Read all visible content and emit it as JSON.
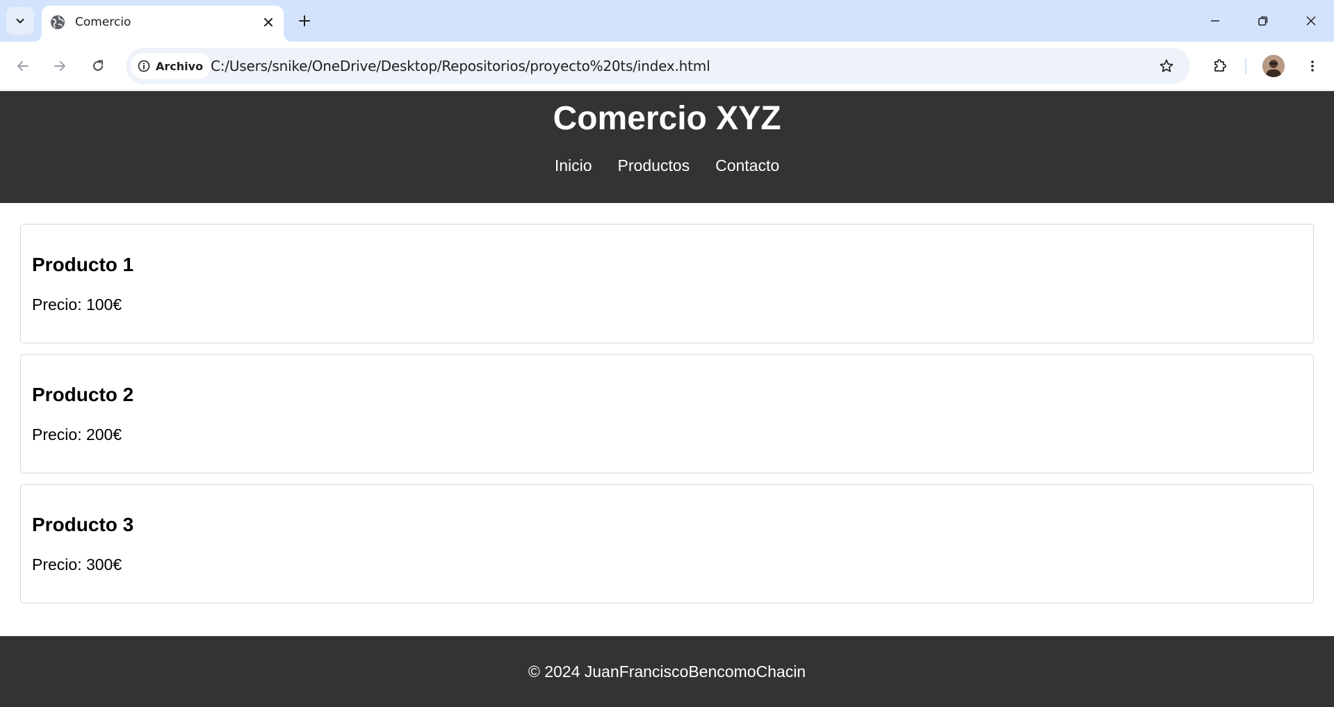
{
  "browser": {
    "tab": {
      "title": "Comercio",
      "favicon": "globe-icon"
    },
    "omnibox": {
      "site_chip": "Archivo",
      "url": "C:/Users/snike/OneDrive/Desktop/Repositorios/proyecto%20ts/index.html"
    },
    "icons": {
      "tab_search": "chevron-down-icon",
      "tab_close": "close-icon",
      "new_tab": "plus-icon",
      "back": "arrow-left-icon",
      "forward": "arrow-right-icon",
      "reload": "reload-icon",
      "site_info": "info-icon",
      "bookmark": "star-icon",
      "extensions": "puzzle-icon",
      "menu": "kebab-menu-icon",
      "minimize": "minimize-icon",
      "restore": "restore-icon",
      "close_window": "close-icon"
    },
    "colors": {
      "tabstrip": "#d3e3fd",
      "omnibox": "#eef2f9"
    }
  },
  "page": {
    "header": {
      "title": "Comercio XYZ",
      "nav": [
        {
          "label": "Inicio"
        },
        {
          "label": "Productos"
        },
        {
          "label": "Contacto"
        }
      ]
    },
    "products": [
      {
        "name": "Producto 1",
        "price": "Precio: 100€"
      },
      {
        "name": "Producto 2",
        "price": "Precio: 200€"
      },
      {
        "name": "Producto 3",
        "price": "Precio: 300€"
      }
    ],
    "footer": {
      "text": "© 2024 JuanFranciscoBencomoChacin"
    },
    "colors": {
      "header_bg": "#333333",
      "footer_bg": "#333333",
      "text_light": "#ffffff"
    }
  }
}
